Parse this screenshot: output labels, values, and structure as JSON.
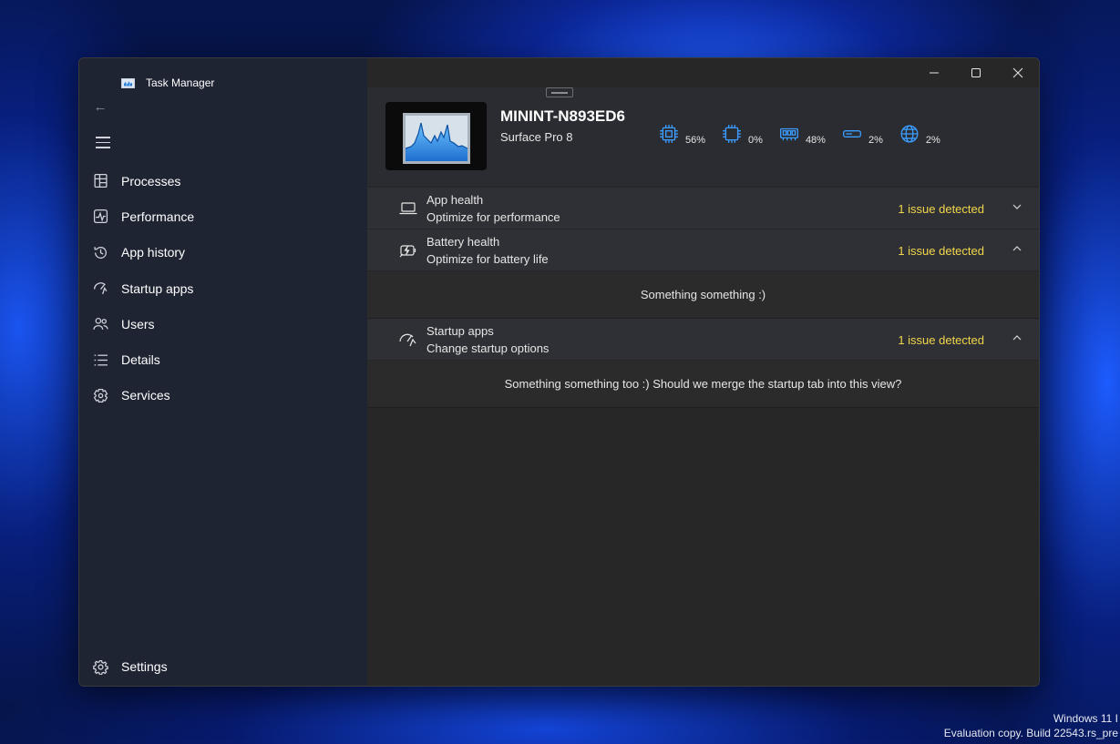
{
  "window": {
    "title": "Task Manager"
  },
  "sidebar": {
    "items": [
      {
        "label": "Processes",
        "icon": "processes-icon"
      },
      {
        "label": "Performance",
        "icon": "performance-icon"
      },
      {
        "label": "App history",
        "icon": "history-icon"
      },
      {
        "label": "Startup apps",
        "icon": "startup-icon"
      },
      {
        "label": "Users",
        "icon": "users-icon"
      },
      {
        "label": "Details",
        "icon": "details-icon"
      },
      {
        "label": "Services",
        "icon": "services-icon"
      }
    ],
    "settings_label": "Settings"
  },
  "device": {
    "name": "MININT-N893ED6",
    "model": "Surface Pro 8"
  },
  "metrics": [
    {
      "icon": "cpu-icon",
      "value": "56%"
    },
    {
      "icon": "gpu-icon",
      "value": "0%"
    },
    {
      "icon": "memory-icon",
      "value": "48%"
    },
    {
      "icon": "disk-icon",
      "value": "2%"
    },
    {
      "icon": "network-icon",
      "value": "2%"
    }
  ],
  "health_rows": [
    {
      "title": "App health",
      "subtitle": "Optimize for performance",
      "status": "1 issue detected",
      "expanded": false,
      "body": ""
    },
    {
      "title": "Battery health",
      "subtitle": "Optimize for battery life",
      "status": "1 issue detected",
      "expanded": true,
      "body": "Something something :)"
    },
    {
      "title": "Startup apps",
      "subtitle": "Change startup options",
      "status": "1 issue detected",
      "expanded": true,
      "body": "Something something too :) Should we merge the startup tab into this view?"
    }
  ],
  "colors": {
    "accent": "#3b9dff",
    "warning": "#f2d64b",
    "sidebar_bg": "#1f2433",
    "main_bg": "#272727"
  },
  "watermark": {
    "line1": "Windows 11 I",
    "line2": "Evaluation copy. Build 22543.rs_pre"
  }
}
